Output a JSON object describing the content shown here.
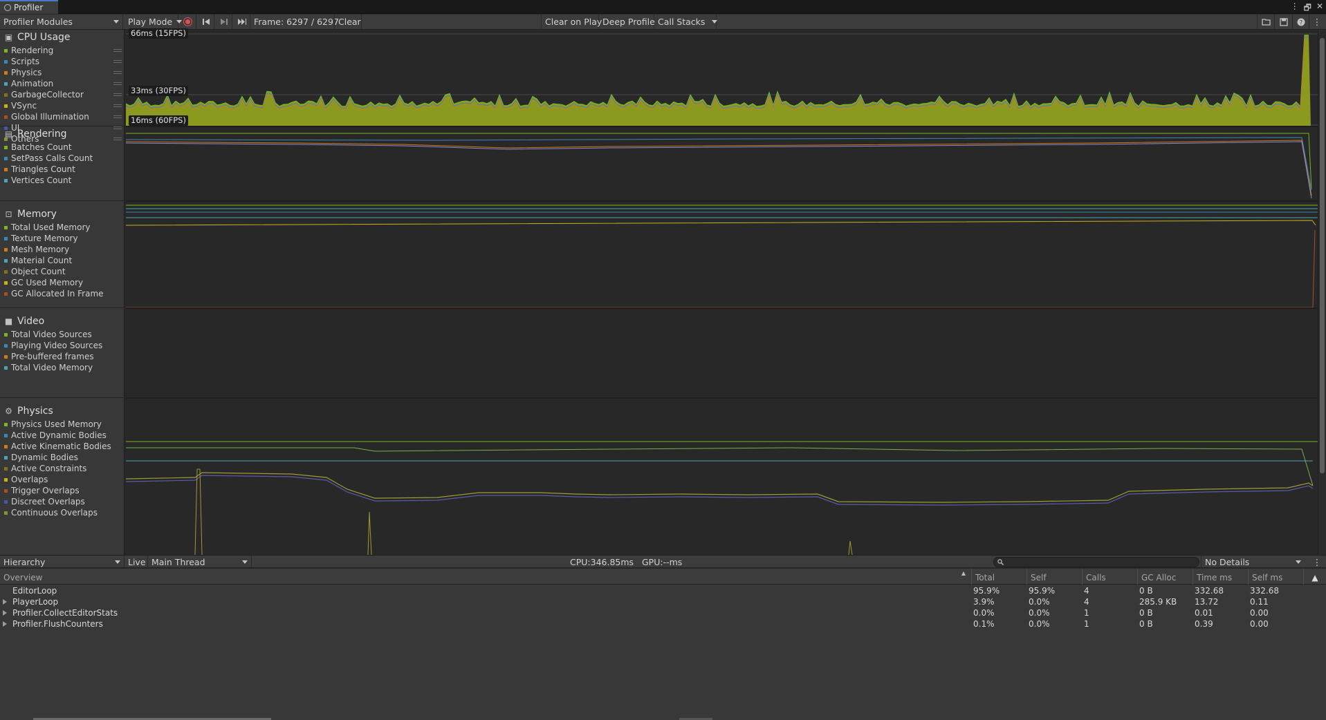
{
  "window": {
    "tab_title": "Profiler",
    "controls": [
      "⋮",
      "🗗",
      "✕"
    ]
  },
  "toolbar": {
    "modules_dropdown": "Profiler Modules",
    "target_dropdown": "Play Mode",
    "frame_label": "Frame: 6297 / 6297",
    "clear_label": "Clear",
    "clear_on_play_label": "Clear on Play",
    "deep_profile_label": "Deep Profile",
    "call_stacks_label": "Call Stacks",
    "icons": [
      "record-icon",
      "previous-frame-icon",
      "next-frame-icon",
      "current-frame-icon",
      "load-icon",
      "save-icon",
      "help-icon",
      "more-icon"
    ]
  },
  "modules": [
    {
      "title": "CPU Usage",
      "icon": "cpu-icon",
      "legend": [
        {
          "label": "Rendering",
          "color": "#7cb51f"
        },
        {
          "label": "Scripts",
          "color": "#3a87b8"
        },
        {
          "label": "Physics",
          "color": "#d3791c"
        },
        {
          "label": "Animation",
          "color": "#4ea3b4"
        },
        {
          "label": "GarbageCollector",
          "color": "#7f7220"
        },
        {
          "label": "VSync",
          "color": "#c9b11a"
        },
        {
          "label": "Global Illumination",
          "color": "#b24b2b"
        },
        {
          "label": "UI",
          "color": "#4c54a8"
        },
        {
          "label": "Others",
          "color": "#8f8f3a"
        }
      ]
    },
    {
      "title": "Rendering",
      "icon": "rendering-icon",
      "legend": [
        {
          "label": "Batches Count",
          "color": "#7cb51f"
        },
        {
          "label": "SetPass Calls Count",
          "color": "#3a87b8"
        },
        {
          "label": "Triangles Count",
          "color": "#d3791c"
        },
        {
          "label": "Vertices Count",
          "color": "#4ea3b4"
        }
      ]
    },
    {
      "title": "Memory",
      "icon": "memory-icon",
      "legend": [
        {
          "label": "Total Used Memory",
          "color": "#7cb51f"
        },
        {
          "label": "Texture Memory",
          "color": "#3a87b8"
        },
        {
          "label": "Mesh Memory",
          "color": "#d3791c"
        },
        {
          "label": "Material Count",
          "color": "#4ea3b4"
        },
        {
          "label": "Object Count",
          "color": "#7f7220"
        },
        {
          "label": "GC Used Memory",
          "color": "#c9b11a"
        },
        {
          "label": "GC Allocated In Frame",
          "color": "#b24b2b"
        }
      ]
    },
    {
      "title": "Video",
      "icon": "video-icon",
      "legend": [
        {
          "label": "Total Video Sources",
          "color": "#7cb51f"
        },
        {
          "label": "Playing Video Sources",
          "color": "#3a87b8"
        },
        {
          "label": "Pre-buffered frames",
          "color": "#d3791c"
        },
        {
          "label": "Total Video Memory",
          "color": "#4ea3b4"
        }
      ]
    },
    {
      "title": "Physics",
      "icon": "physics-icon",
      "legend": [
        {
          "label": "Physics Used Memory",
          "color": "#7cb51f"
        },
        {
          "label": "Active Dynamic Bodies",
          "color": "#3a87b8"
        },
        {
          "label": "Active Kinematic Bodies",
          "color": "#d3791c"
        },
        {
          "label": "Dynamic Bodies",
          "color": "#4ea3b4"
        },
        {
          "label": "Active Constraints",
          "color": "#7f7220"
        },
        {
          "label": "Overlaps",
          "color": "#c9b11a"
        },
        {
          "label": "Trigger Overlaps",
          "color": "#b24b2b"
        },
        {
          "label": "Discreet Overlaps",
          "color": "#4c54a8"
        },
        {
          "label": "Continuous Overlaps",
          "color": "#8f8f3a"
        }
      ]
    }
  ],
  "cpu_chart": {
    "fps_markers": [
      "66ms (15FPS)",
      "33ms (30FPS)",
      "16ms (60FPS)"
    ]
  },
  "details_bar": {
    "view_dropdown": "Hierarchy",
    "live_label": "Live",
    "thread_dropdown": "Main Thread",
    "cpu_gpu_text": "CPU:346.85ms   GPU:--ms",
    "search_icon": "search-icon",
    "details_dropdown": "No Details"
  },
  "table": {
    "columns": [
      "Overview",
      "Total",
      "Self",
      "Calls",
      "GC Alloc",
      "Time ms",
      "Self ms"
    ],
    "rows": [
      {
        "name": "EditorLoop",
        "expandable": false,
        "total": "95.9%",
        "self": "95.9%",
        "calls": "4",
        "gc_alloc": "0 B",
        "time_ms": "332.68",
        "self_ms": "332.68"
      },
      {
        "name": "PlayerLoop",
        "expandable": true,
        "total": "3.9%",
        "self": "0.0%",
        "calls": "4",
        "gc_alloc": "285.9 KB",
        "time_ms": "13.72",
        "self_ms": "0.11"
      },
      {
        "name": "Profiler.CollectEditorStats",
        "expandable": true,
        "total": "0.0%",
        "self": "0.0%",
        "calls": "1",
        "gc_alloc": "0 B",
        "time_ms": "0.01",
        "self_ms": "0.00"
      },
      {
        "name": "Profiler.FlushCounters",
        "expandable": true,
        "total": "0.1%",
        "self": "0.0%",
        "calls": "1",
        "gc_alloc": "0 B",
        "time_ms": "0.39",
        "self_ms": "0.00"
      }
    ]
  }
}
